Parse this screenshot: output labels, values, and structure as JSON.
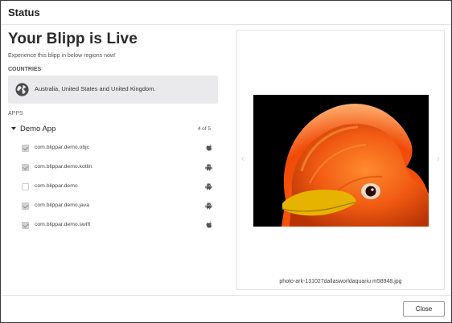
{
  "header": {
    "title": "Status"
  },
  "main": {
    "title": "Your Blipp is Live",
    "subtitle": "Experience this blipp in below regions now!",
    "countries_label": "COUNTRIES",
    "countries_text": "Australia, United States and United Kingdom.",
    "apps_label": "APPS",
    "app_group": {
      "name": "Demo App",
      "count": "4 of 5"
    },
    "packages": [
      {
        "name": "com.blippar.demo.objc",
        "checked": true,
        "platform": "apple-icon"
      },
      {
        "name": "com.blippar.demo.kotlin",
        "checked": true,
        "platform": "android-icon"
      },
      {
        "name": "com.blippar.demo",
        "checked": false,
        "platform": "android-icon"
      },
      {
        "name": "com.blippar.demo.java",
        "checked": true,
        "platform": "android-icon"
      },
      {
        "name": "com.blippar.demo.swift",
        "checked": true,
        "platform": "apple-icon"
      }
    ]
  },
  "preview": {
    "prev_arrow": "‹",
    "next_arrow": "›",
    "caption": "photo-ark-131027dallasworldaquariu m58948.jpg"
  },
  "footer": {
    "close_label": "Close"
  },
  "colors": {
    "countries_bg": "#eaeaec",
    "bird_orange": "#f05a12",
    "beak_yellow": "#e6b400"
  }
}
